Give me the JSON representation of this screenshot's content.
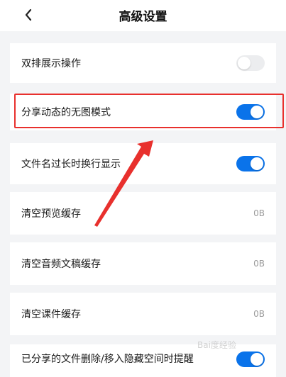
{
  "header": {
    "back_icon": "chevron-left-icon",
    "title": "高级设置"
  },
  "settings": [
    {
      "label": "双排展示操作",
      "type": "toggle",
      "state": "off"
    },
    {
      "label": "分享动态的无图模式",
      "type": "toggle",
      "state": "on"
    },
    {
      "label": "文件名过长时换行显示",
      "type": "toggle",
      "state": "on"
    },
    {
      "label": "清空预览缓存",
      "type": "value",
      "value": "0B"
    },
    {
      "label": "清空音频文稿缓存",
      "type": "value",
      "value": "0B"
    },
    {
      "label": "清空课件缓存",
      "type": "value",
      "value": "0B"
    },
    {
      "label": "已分享的文件删除/移入隐藏空间时提醒",
      "type": "toggle",
      "state": "on"
    }
  ],
  "colors": {
    "toggle_on": "#0a73ea",
    "toggle_off": "#ecedef",
    "highlight": "#e8302d"
  },
  "watermark": "Bai度经验"
}
